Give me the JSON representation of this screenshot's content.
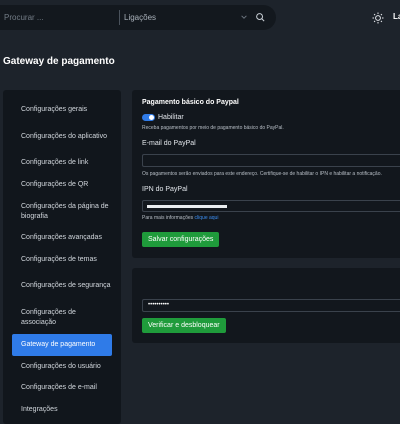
{
  "search": {
    "placeholder": "Procurar ...",
    "filter_selected": "Ligações"
  },
  "header": {
    "user_label": "La"
  },
  "page": {
    "title": "Gateway de pagamento"
  },
  "sidebar": {
    "items": [
      {
        "label": "Configurações gerais"
      },
      {
        "label": "Configurações do aplicativo"
      },
      {
        "label": "Configurações de link"
      },
      {
        "label": "Configurações de QR"
      },
      {
        "label": "Configurações da página de biografia"
      },
      {
        "label": "Configurações avançadas"
      },
      {
        "label": "Configurações de temas"
      },
      {
        "label": "Configurações de segurança"
      },
      {
        "label": "Configurações de associação"
      },
      {
        "label": "Gateway de pagamento"
      },
      {
        "label": "Configurações do usuário"
      },
      {
        "label": "Configurações de e-mail"
      },
      {
        "label": "Integrações"
      }
    ],
    "active_index": 9
  },
  "paypal": {
    "title": "Pagamento básico do Paypal",
    "enable_label": "Habilitar",
    "enabled": true,
    "description": "Receba pagamentos por meio de pagamento básico do PayPal.",
    "email_label": "E-mail do PayPal",
    "email_value": "",
    "email_help": "Os pagamentos serão enviados para este endereço. Certifique-se de habilitar o IPN e habilitar a notificação.",
    "ipn_label": "IPN do PayPal",
    "ipn_help_prefix": "Para mais informações ",
    "ipn_help_link": "clique aqui",
    "save_button": "Salvar configurações"
  },
  "unlock": {
    "field_value": "••••••••••",
    "button": "Verificar e desbloquear"
  },
  "colors": {
    "accent": "#2f7be8",
    "success": "#1f9b3b",
    "link": "#3b8df0"
  }
}
